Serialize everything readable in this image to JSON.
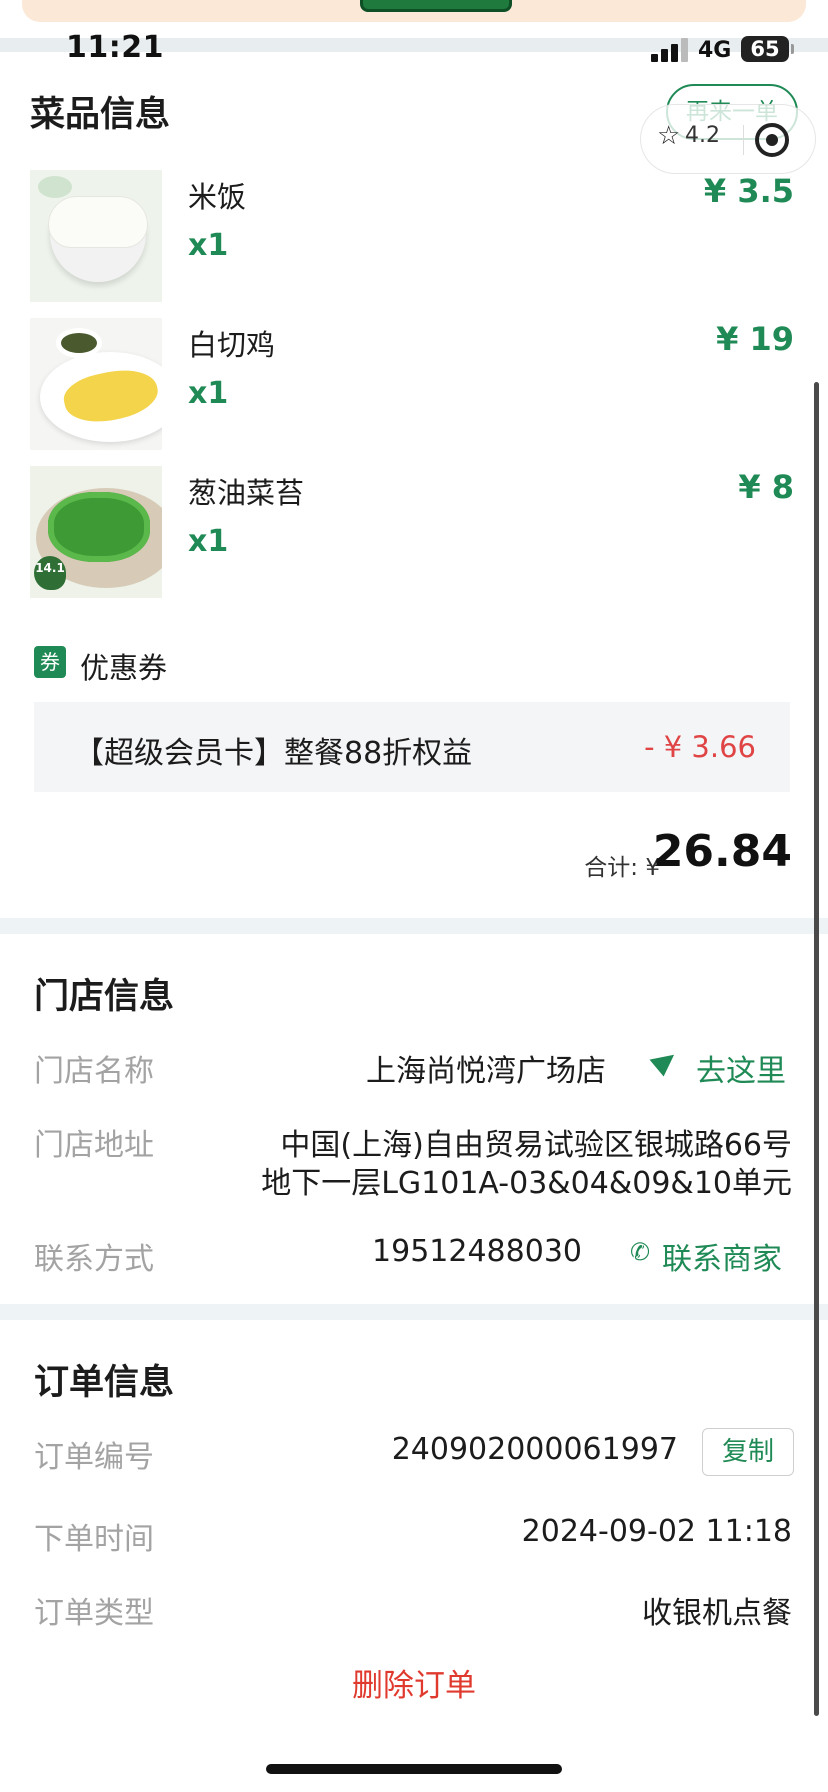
{
  "status_bar": {
    "time": "11:21",
    "network": "4G",
    "battery": "65"
  },
  "capsule": {
    "rating": "4.2",
    "star_icon": "star-outline-icon",
    "target_icon": "target-icon"
  },
  "dishes_section": {
    "title": "菜品信息",
    "reorder_label": "再来一单",
    "items": [
      {
        "name": "米饭",
        "qty": "x1",
        "price": "¥ 3.5",
        "image": "rice-bowl"
      },
      {
        "name": "白切鸡",
        "qty": "x1",
        "price": "¥ 19",
        "image": "white-cut-chicken"
      },
      {
        "name": "葱油菜苔",
        "qty": "x1",
        "price": "¥ 8",
        "image": "scallion-oil-greens",
        "badge": "14.1"
      }
    ]
  },
  "coupon": {
    "tag": "券",
    "label": "优惠券",
    "name": "【超级会员卡】整餐88折权益",
    "amount": "- ¥ 3.66"
  },
  "total": {
    "label": "合计: ¥",
    "value": "26.84"
  },
  "store_section": {
    "title": "门店信息",
    "name_label": "门店名称",
    "name_value": "上海尚悦湾广场店",
    "navigate_label": "去这里",
    "address_label": "门店地址",
    "address_line1": "中国(上海)自由贸易试验区银城路66号",
    "address_line2": "地下一层LG101A-03&04&09&10单元",
    "contact_label": "联系方式",
    "contact_value": "19512488030",
    "contact_action": "联系商家"
  },
  "order_section": {
    "title": "订单信息",
    "number_label": "订单编号",
    "number_value": "240902000061997",
    "copy_label": "复制",
    "time_label": "下单时间",
    "time_value": "2024-09-02 11:18",
    "type_label": "订单类型",
    "type_value": "收银机点餐"
  },
  "delete_label": "删除订单",
  "colors": {
    "accent": "#1f8a55",
    "danger": "#e04545",
    "muted": "#a3a3a3",
    "band": "#eef3f5"
  }
}
